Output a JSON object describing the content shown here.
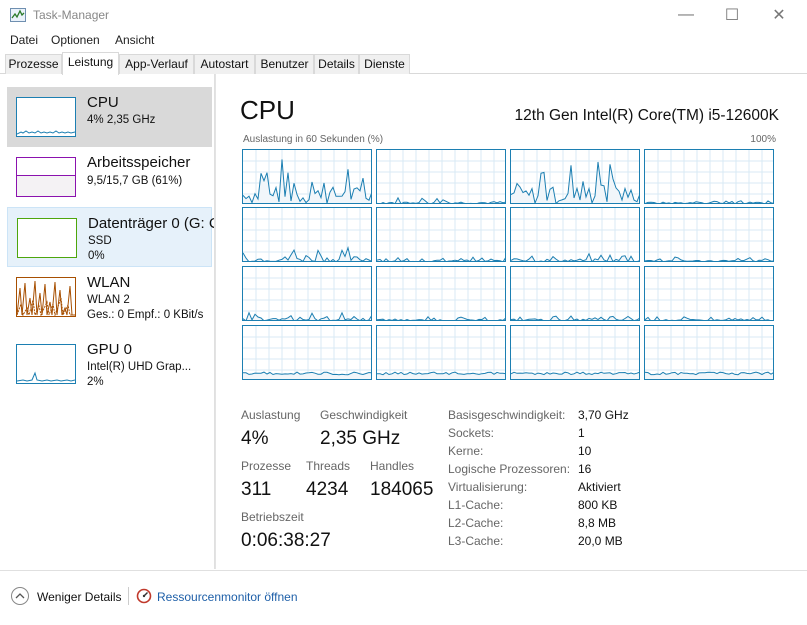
{
  "window": {
    "title": "Task-Manager",
    "minimize_glyph": "—",
    "maximize_glyph": "☐",
    "close_glyph": "✕"
  },
  "menu": [
    "Datei",
    "Optionen",
    "Ansicht"
  ],
  "tabs": [
    "Prozesse",
    "Leistung",
    "App-Verlauf",
    "Autostart",
    "Benutzer",
    "Details",
    "Dienste"
  ],
  "active_tab": "Leistung",
  "sidebar": {
    "items": [
      {
        "title": "CPU",
        "line1": "4% 2,35 GHz",
        "line2": "",
        "selected": true,
        "color": "#1c7fb2",
        "icon": "cpu-thumbnail-graph"
      },
      {
        "title": "Arbeitsspeicher",
        "line1": "9,5/15,7 GB (61%)",
        "line2": "",
        "color": "#8b12ae",
        "icon": "memory-thumbnail-graph"
      },
      {
        "title": "Datenträger 0 (G: C",
        "line1": "SSD",
        "line2": "0%",
        "hovered": true,
        "color": "#4da60c",
        "icon": "disk-thumbnail-graph"
      },
      {
        "title": "WLAN",
        "line1": "WLAN 2",
        "line2": "Ges.: 0 Empf.: 0 KBit/s",
        "color": "#a74f01",
        "icon": "wlan-thumbnail-graph"
      },
      {
        "title": "GPU 0",
        "line1": "Intel(R) UHD Grap...",
        "line2": "2%",
        "color": "#1c7fb2",
        "icon": "gpu-thumbnail-graph"
      }
    ]
  },
  "main": {
    "title": "CPU",
    "model": "12th Gen Intel(R) Core(TM) i5-12600K",
    "graph_label": "Auslastung in 60 Sekunden (%)",
    "graph_max": "100%",
    "graph_color": "#1c7fb2",
    "logical_processor_graph_count": 16,
    "stats": {
      "auslastung_label": "Auslastung",
      "auslastung_value": "4%",
      "geschwindigkeit_label": "Geschwindigkeit",
      "geschwindigkeit_value": "2,35 GHz",
      "prozesse_label": "Prozesse",
      "prozesse_value": "311",
      "threads_label": "Threads",
      "threads_value": "4234",
      "handles_label": "Handles",
      "handles_value": "184065",
      "betriebszeit_label": "Betriebszeit",
      "betriebszeit_value": "0:06:38:27"
    },
    "info": [
      {
        "label": "Basisgeschwindigkeit:",
        "value": "3,70 GHz"
      },
      {
        "label": "Sockets:",
        "value": "1"
      },
      {
        "label": "Kerne:",
        "value": "10"
      },
      {
        "label": "Logische Prozessoren:",
        "value": "16"
      },
      {
        "label": "Virtualisierung:",
        "value": "Aktiviert"
      },
      {
        "label": "L1-Cache:",
        "value": "800 KB"
      },
      {
        "label": "L2-Cache:",
        "value": "8,8 MB"
      },
      {
        "label": "L3-Cache:",
        "value": "20,0 MB"
      }
    ]
  },
  "footer": {
    "fewer_details": "Weniger Details",
    "resource_monitor": "Ressourcenmonitor öffnen"
  }
}
